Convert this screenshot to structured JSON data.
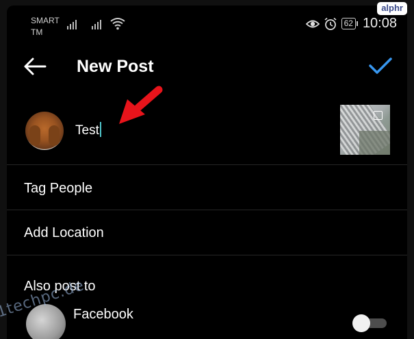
{
  "status_bar": {
    "carrier": "SMART TM",
    "battery": "62",
    "time": "10:08"
  },
  "badge": "alphr",
  "header": {
    "title": "New Post"
  },
  "compose": {
    "caption": "Test"
  },
  "menu": {
    "tag_people": "Tag People",
    "add_location": "Add Location",
    "also_post_to": "Also post to"
  },
  "share": {
    "facebook_label": "Facebook",
    "facebook_toggle_on": false
  },
  "watermark": "1techpc.de",
  "colors": {
    "accent": "#3897f0",
    "arrow": "#e8141b",
    "background": "#000000"
  }
}
